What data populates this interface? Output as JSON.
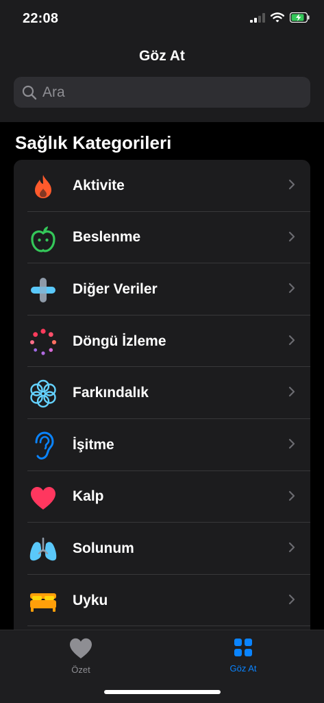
{
  "status": {
    "time": "22:08"
  },
  "nav": {
    "title": "Göz At"
  },
  "search": {
    "placeholder": "Ara"
  },
  "section": {
    "title": "Sağlık Kategorileri"
  },
  "categories": [
    {
      "label": "Aktivite",
      "icon": "flame-icon",
      "color": "#ff5a2c"
    },
    {
      "label": "Beslenme",
      "icon": "apple-icon",
      "color": "#34c759"
    },
    {
      "label": "Diğer Veriler",
      "icon": "plus-icon",
      "color": "#5ac8fa"
    },
    {
      "label": "Döngü İzleme",
      "icon": "cycle-dots-icon",
      "color": "#ff3b5c"
    },
    {
      "label": "Farkındalık",
      "icon": "flower-icon",
      "color": "#64d2ff"
    },
    {
      "label": "İşitme",
      "icon": "ear-icon",
      "color": "#0a84ff"
    },
    {
      "label": "Kalp",
      "icon": "heart-icon",
      "color": "#ff375f"
    },
    {
      "label": "Solunum",
      "icon": "lungs-icon",
      "color": "#5ac8fa"
    },
    {
      "label": "Uyku",
      "icon": "bed-icon",
      "color": "#ff9f0a"
    }
  ],
  "tabbar": {
    "tabs": [
      {
        "label": "Özet",
        "icon": "heart-icon",
        "color": "#8e8e93"
      },
      {
        "label": "Göz At",
        "icon": "grid-icon",
        "color": "#0a84ff"
      }
    ]
  }
}
